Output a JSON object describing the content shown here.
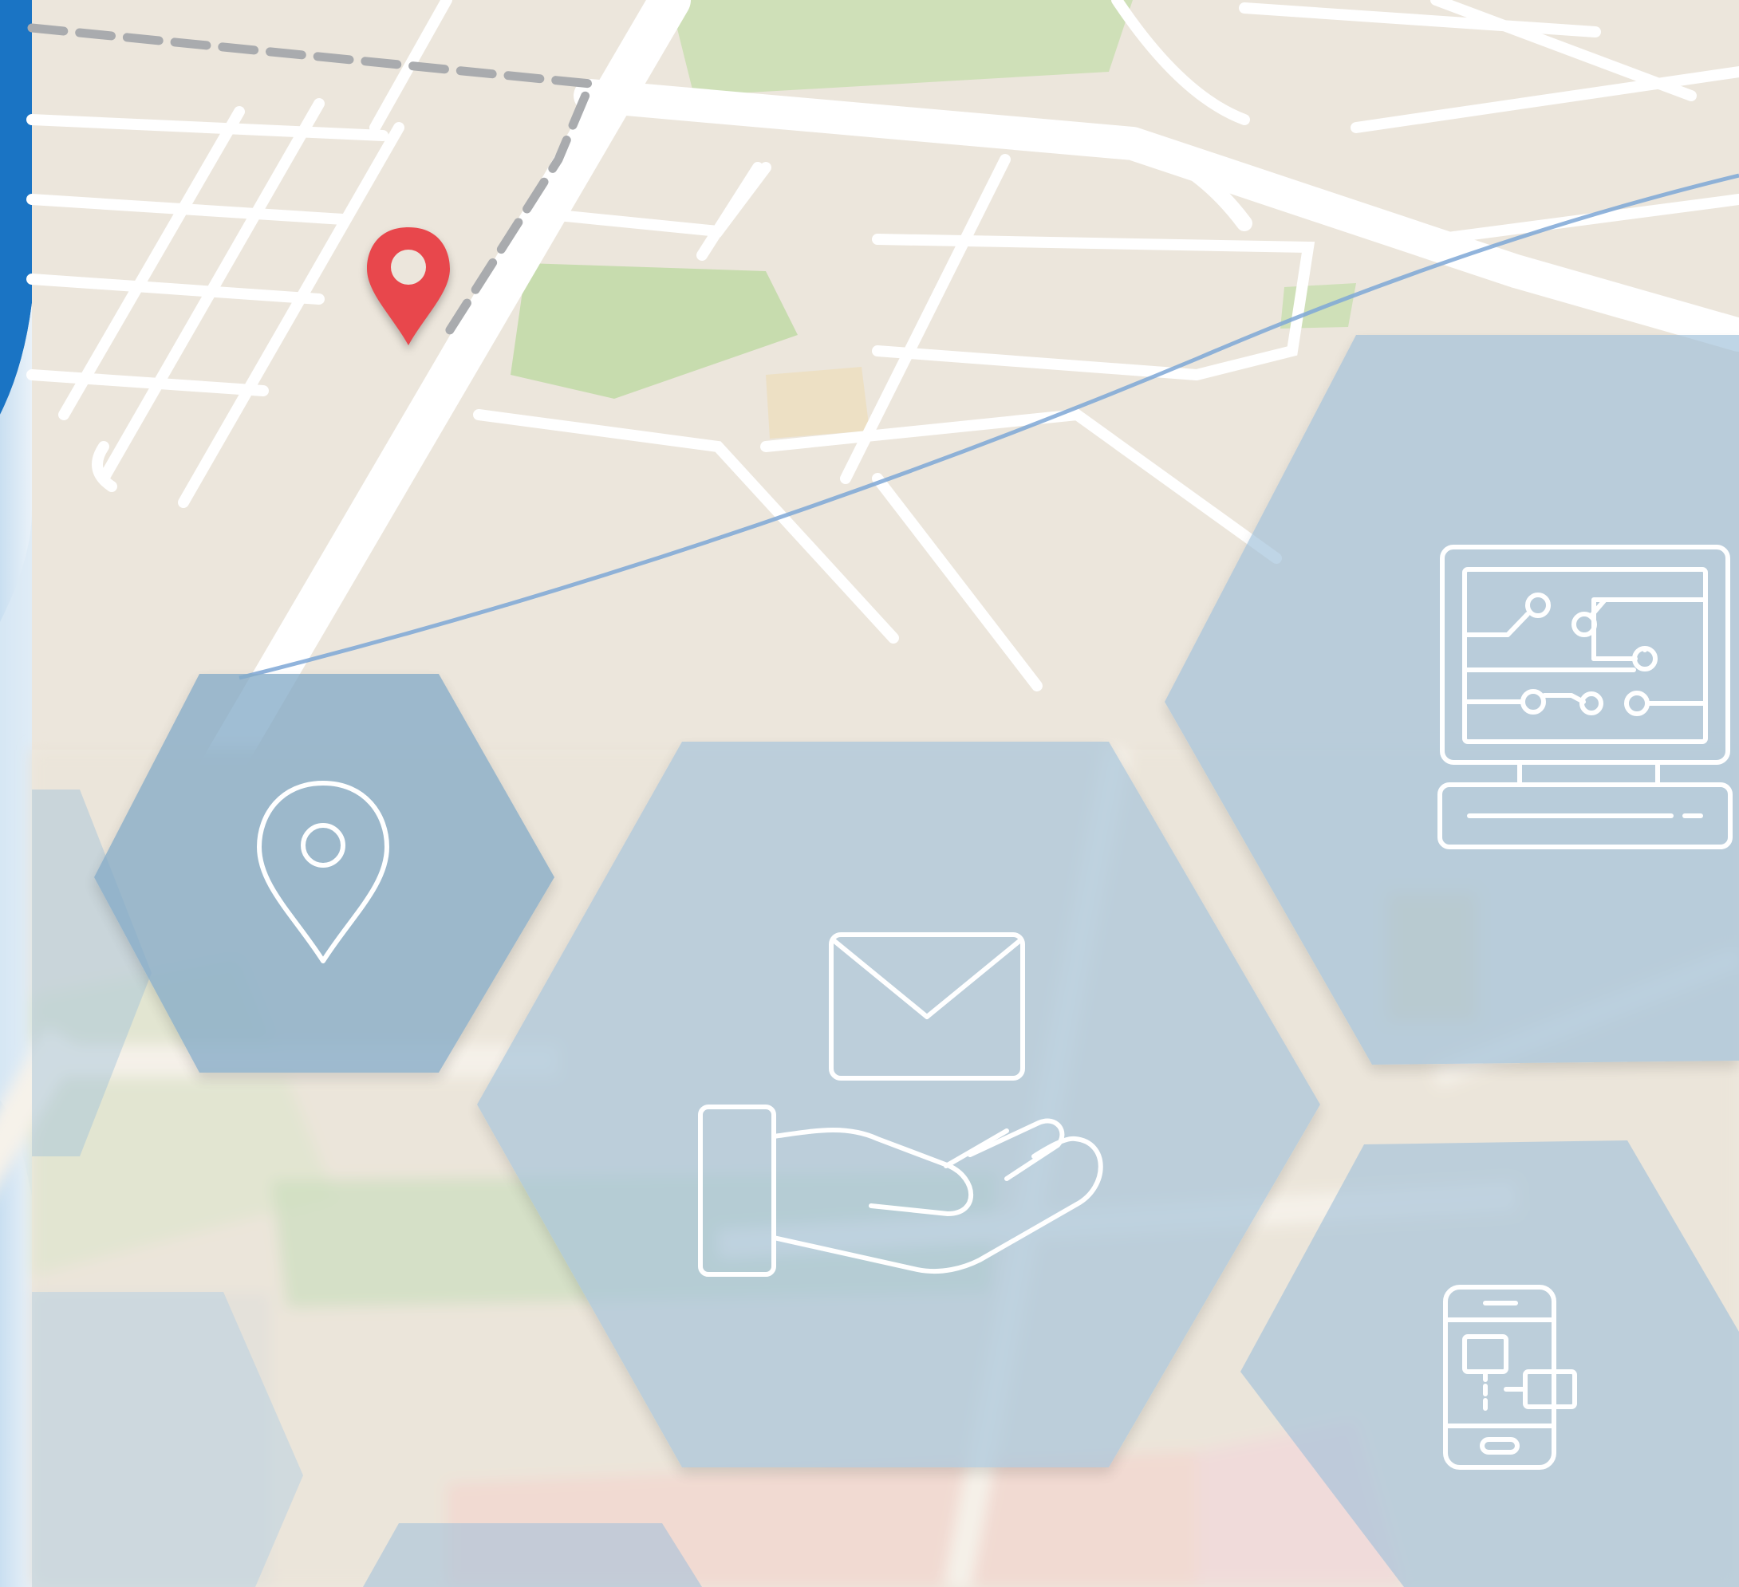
{
  "palette": {
    "map_background": "#ece6dc",
    "road": "#ffffff",
    "park": "#cfe0b8",
    "sand_block": "#efdcb4",
    "route_dash": "#a9abae",
    "water_line": "#7ea7d6",
    "marker_red": "#e8474c",
    "hexagon_fill": "#9fc0da",
    "hexagon_fill_strong": "#86acc8",
    "icon_stroke": "#ffffff",
    "left_accent_blue": "#1a74c4"
  },
  "icons": {
    "map_marker": "map-pin-icon",
    "location": "location-pin-icon",
    "mail_service": "envelope-in-hand-icon",
    "computer": "computer-circuit-icon",
    "mobile": "smartphone-icon"
  }
}
